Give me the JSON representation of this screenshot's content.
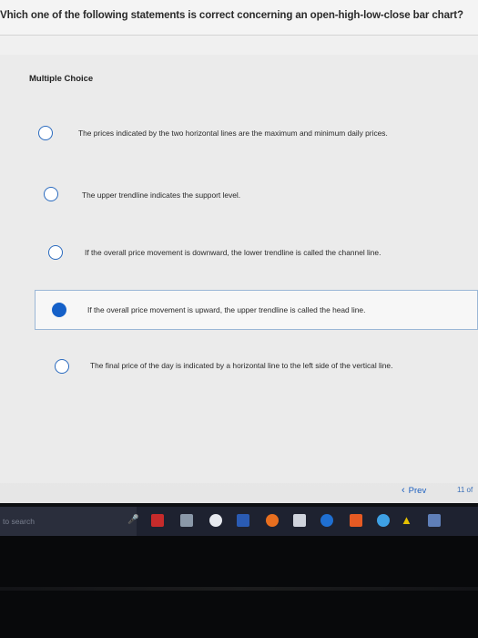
{
  "question": {
    "text": "Vhich one of the following statements is correct concerning an open-high-low-close bar chart?"
  },
  "section_label": "Multiple Choice",
  "options": [
    {
      "text": "The prices indicated by the two horizontal lines are the maximum and minimum daily prices.",
      "selected": false
    },
    {
      "text": "The upper trendline indicates the support level.",
      "selected": false
    },
    {
      "text": "If the overall price movement is downward, the lower trendline is called the channel line.",
      "selected": false
    },
    {
      "text": "If the overall price movement is upward, the upper trendline is called the head line.",
      "selected": true
    },
    {
      "text": "The final price of the day is indicated by a horizontal line to the left side of the vertical line.",
      "selected": false
    }
  ],
  "navigation": {
    "prev_label": "Prev",
    "page_indicator": "11 of"
  },
  "taskbar": {
    "search_placeholder": "to search",
    "icons": [
      "windows-icon",
      "acrobat-icon",
      "files-icon",
      "chrome-icon",
      "word-icon",
      "firefox-icon",
      "store-icon",
      "edge-icon",
      "office-icon",
      "ie-icon",
      "warning-icon",
      "photo-icon"
    ]
  },
  "colors": {
    "accent": "#1560c8",
    "radio_border": "#2b6bbf",
    "selected_border": "#9bb7d6"
  }
}
